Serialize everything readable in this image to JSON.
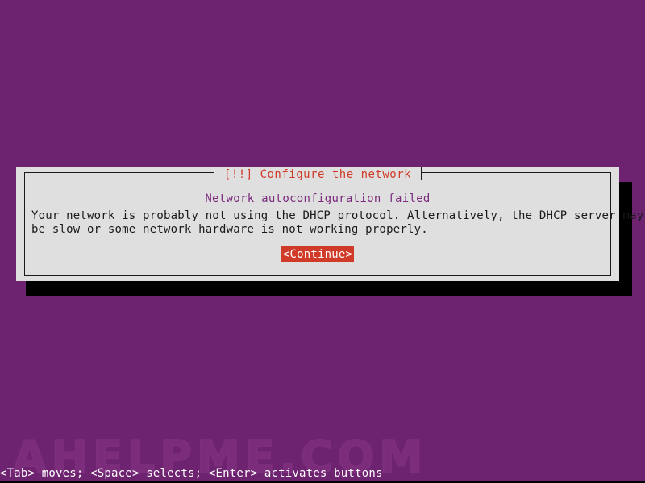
{
  "screen": {
    "background_color": "#6e2370",
    "watermark_text": "AHELPME.COM"
  },
  "dialog": {
    "title": "[!!] Configure the network",
    "title_color": "#cf3b28",
    "background_color": "#dfdfdf",
    "border_color": "#1a1a1a",
    "headline": "Network autoconfiguration failed",
    "headline_color": "#7b2a7e",
    "body_lines": [
      "Your network is probably not using the DHCP protocol. Alternatively, the DHCP server may",
      "be slow or some network hardware is not working properly."
    ],
    "buttons": [
      {
        "label": "<Continue>",
        "selected": true,
        "background_color": "#cf3b28",
        "text_color": "#ffffff"
      }
    ]
  },
  "status_bar": {
    "text": "<Tab> moves; <Space> selects; <Enter> activates buttons",
    "text_color": "#ffffff"
  }
}
